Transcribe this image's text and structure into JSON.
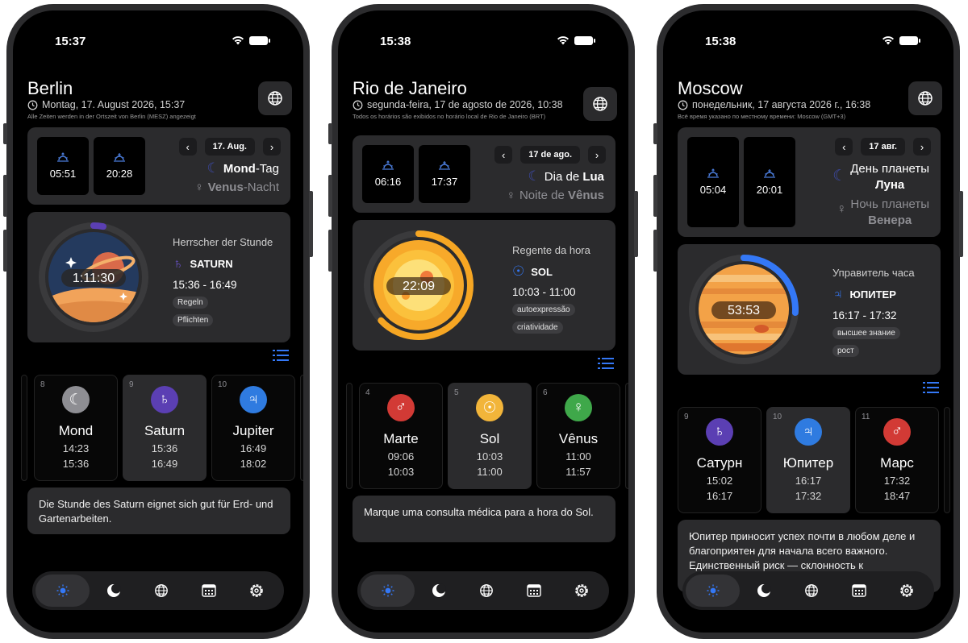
{
  "phones": [
    {
      "status_time": "15:37",
      "city": "Berlin",
      "date_line": "Montag, 17. August 2026, 15:37",
      "tz_note": "Alle Zeiten werden in der Ortszeit von Berlin (MESZ) angezeigt",
      "sunrise": "05:51",
      "sunset": "20:28",
      "date_chip": "17. Aug.",
      "day_ruler_bold": "Mond",
      "day_ruler_rest": "-Tag",
      "night_ruler_bold": "Venus",
      "night_ruler_rest": "-Nacht",
      "ring_time": "1:11:30",
      "ring_progress": 0.03,
      "hour_label": "Herrscher der Stunde",
      "hour_planet": "SATURN",
      "hour_range": "15:36  -  16:49",
      "tags": [
        "Regeln",
        "Pflichten"
      ],
      "hours": [
        {
          "num": "8",
          "name": "Mond",
          "start": "14:23",
          "end": "15:36",
          "color": "#8e8e93",
          "glyph": "☾"
        },
        {
          "num": "9",
          "name": "Saturn",
          "start": "15:36",
          "end": "16:49",
          "color": "#5b3fb3",
          "glyph": "♄"
        },
        {
          "num": "10",
          "name": "Jupiter",
          "start": "16:49",
          "end": "18:02",
          "color": "#2f7be0",
          "glyph": "♃"
        }
      ],
      "advice": "Die Stunde des Saturn eignet sich gut für Erd- und Gartenarbeiten."
    },
    {
      "status_time": "15:38",
      "city": "Rio de Janeiro",
      "date_line": "segunda-feira, 17 de agosto de 2026, 10:38",
      "tz_note": "Todos os horários são exibidos no horário local de Rio de Janeiro (BRT)",
      "sunrise": "06:16",
      "sunset": "17:37",
      "date_chip": "17 de ago.",
      "day_ruler_bold": "Lua",
      "day_ruler_pre": "Dia de ",
      "night_ruler_bold": "Vênus",
      "night_ruler_pre": "Noite de ",
      "ring_time": "22:09",
      "ring_progress": 0.63,
      "hour_label": "Regente da hora",
      "hour_planet": "SOL",
      "hour_range": "10:03  -  11:00",
      "tags": [
        "autoexpressão",
        "criatividade"
      ],
      "hours": [
        {
          "num": "4",
          "name": "Marte",
          "start": "09:06",
          "end": "10:03",
          "color": "#d23a35",
          "glyph": "♂"
        },
        {
          "num": "5",
          "name": "Sol",
          "start": "10:03",
          "end": "11:00",
          "color": "#f2b53a",
          "glyph": "☉"
        },
        {
          "num": "6",
          "name": "Vênus",
          "start": "11:00",
          "end": "11:57",
          "color": "#3fa84a",
          "glyph": "♀"
        }
      ],
      "advice": "Marque uma consulta médica para a hora do Sol."
    },
    {
      "status_time": "15:38",
      "city": "Moscow",
      "date_line": "понедельник, 17 августа 2026 г., 16:38",
      "tz_note": "Всё время указано по местному времени: Moscow (GMT+3)",
      "sunrise": "05:04",
      "sunset": "20:01",
      "date_chip": "17 авг.",
      "day_ruler_pre": "День планеты",
      "day_ruler_bold": "Луна",
      "night_ruler_pre": "Ночь планеты",
      "night_ruler_bold": "Венера",
      "ring_time": "53:53",
      "ring_progress": 0.26,
      "hour_label": "Управитель часа",
      "hour_planet": "ЮПИТЕР",
      "hour_range": "16:17  -  17:32",
      "tags": [
        "высшее знание",
        "рост"
      ],
      "hours": [
        {
          "num": "9",
          "name": "Сатурн",
          "start": "15:02",
          "end": "16:17",
          "color": "#5b3fb3",
          "glyph": "♄"
        },
        {
          "num": "10",
          "name": "Юпитер",
          "start": "16:17",
          "end": "17:32",
          "color": "#2f7be0",
          "glyph": "♃"
        },
        {
          "num": "11",
          "name": "Марс",
          "start": "17:32",
          "end": "18:47",
          "color": "#d23a35",
          "glyph": "♂"
        }
      ],
      "advice": "Юпитер приносит успех почти в любом деле и благоприятен для начала всего важного. Единственный риск — склонность к излишествам."
    }
  ],
  "colors": {
    "accent": "#3478f6",
    "moon": "#3d4aa8",
    "ring_track": "#3a3a3c",
    "ring_sun": "#f6a623",
    "ring_jupiter": "#3478f6"
  }
}
